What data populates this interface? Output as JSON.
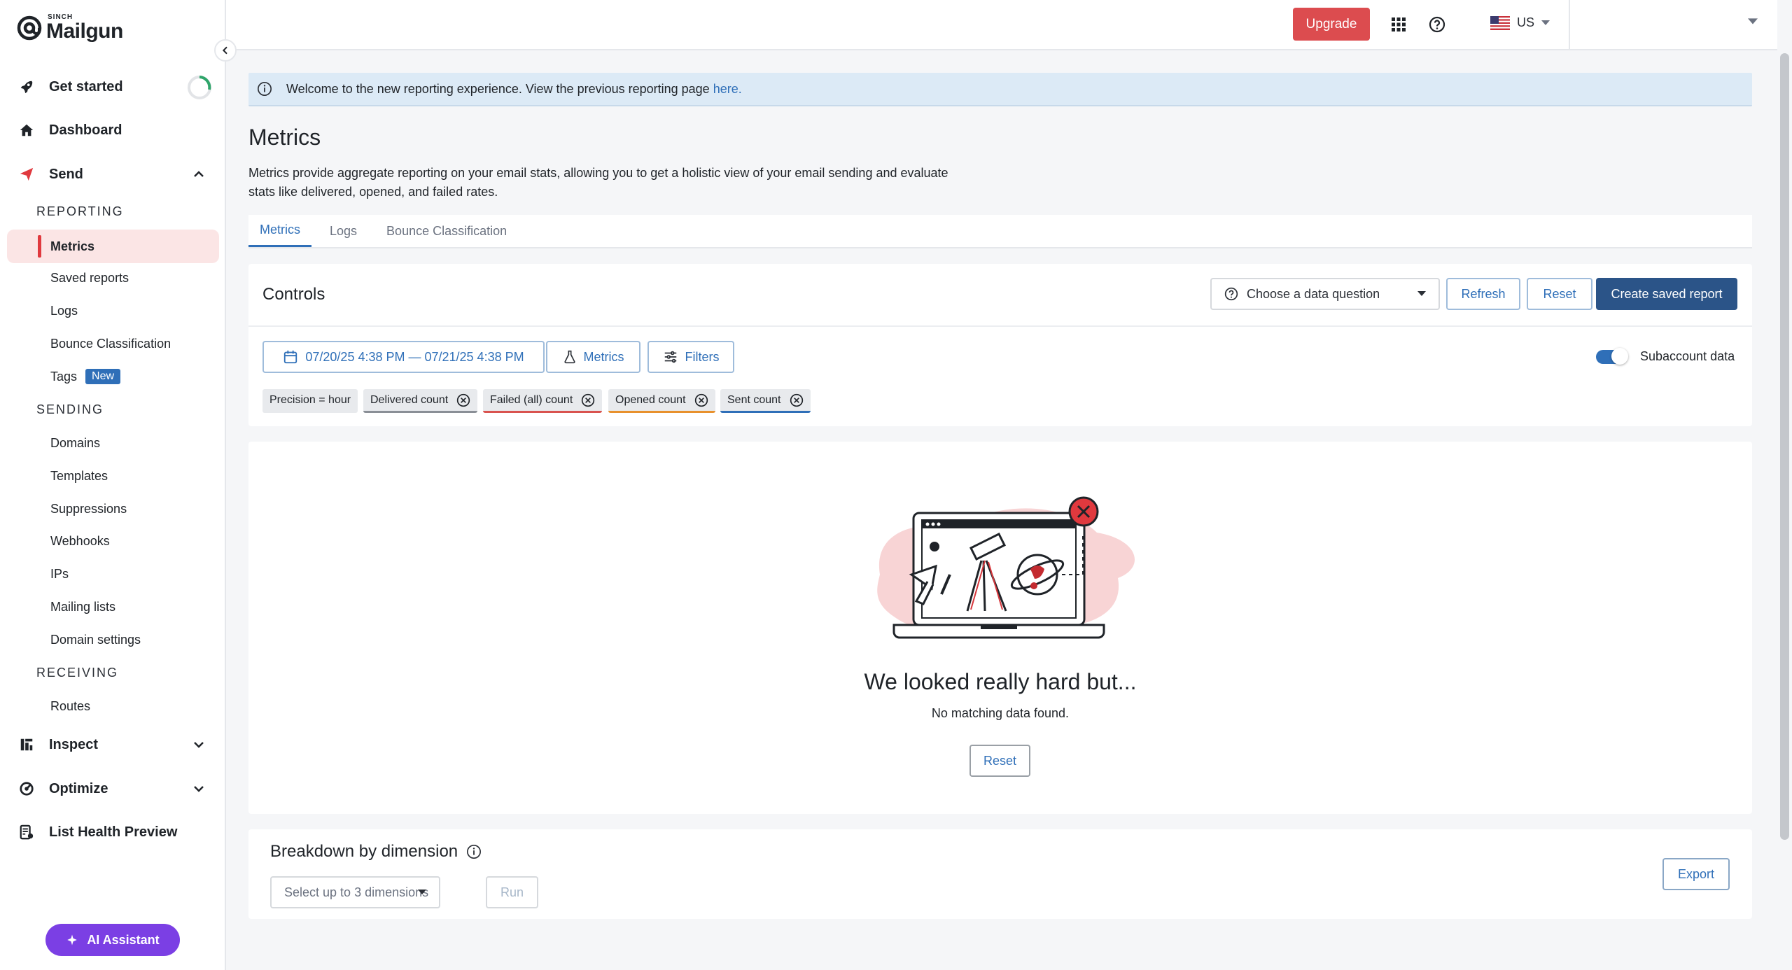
{
  "app": {
    "brand_small": "SINCH",
    "brand_name": "Mailgun"
  },
  "sidebar": {
    "top_items": [
      {
        "label": "Get started",
        "icon": "rocket-icon"
      },
      {
        "label": "Dashboard",
        "icon": "home-icon"
      },
      {
        "label": "Send",
        "icon": "send-icon"
      }
    ],
    "reporting_header": "REPORTING",
    "reporting_items": [
      "Metrics",
      "Saved reports",
      "Logs",
      "Bounce Classification",
      "Tags"
    ],
    "tags_badge": "New",
    "sending_header": "SENDING",
    "sending_items": [
      "Domains",
      "Templates",
      "Suppressions",
      "Webhooks",
      "IPs",
      "Mailing lists",
      "Domain settings"
    ],
    "receiving_header": "RECEIVING",
    "receiving_items": [
      "Routes"
    ],
    "bottom_items": [
      {
        "label": "Inspect",
        "icon": "inspect-icon"
      },
      {
        "label": "Optimize",
        "icon": "optimize-icon"
      },
      {
        "label": "List Health Preview",
        "icon": "list-health-icon"
      }
    ],
    "ai_assistant_label": "AI Assistant",
    "active_item": "Metrics"
  },
  "topbar": {
    "upgrade_label": "Upgrade",
    "region_label": "US"
  },
  "banner": {
    "text": "Welcome to the new reporting experience. View the previous reporting page",
    "link_text": "here."
  },
  "page": {
    "title": "Metrics",
    "description": "Metrics provide aggregate reporting on your email stats, allowing you to get a holistic view of your email sending and evaluate stats like delivered, opened, and failed rates."
  },
  "tabs": [
    {
      "label": "Metrics",
      "active": true
    },
    {
      "label": "Logs",
      "active": false
    },
    {
      "label": "Bounce Classification",
      "active": false
    }
  ],
  "controls": {
    "title": "Controls",
    "data_question_label": "Choose a data question",
    "refresh_label": "Refresh",
    "reset_label": "Reset",
    "create_saved_report_label": "Create saved report",
    "date_range": "07/20/25 4:38 PM — 07/21/25 4:38 PM",
    "metrics_label": "Metrics",
    "filters_label": "Filters",
    "subaccount_label": "Subaccount data",
    "subaccount_enabled": true,
    "chips": [
      {
        "label": "Precision = hour",
        "removable": false,
        "color": "#e8eaed"
      },
      {
        "label": "Delivered count",
        "removable": true,
        "color": "#8a8f96"
      },
      {
        "label": "Failed (all) count",
        "removable": true,
        "color": "#d9534f"
      },
      {
        "label": "Opened count",
        "removable": true,
        "color": "#e8912d"
      },
      {
        "label": "Sent count",
        "removable": true,
        "color": "#2f6fb8"
      }
    ]
  },
  "empty_state": {
    "title": "We looked really hard but...",
    "subtitle": "No matching data found.",
    "reset_label": "Reset"
  },
  "breakdown": {
    "title": "Breakdown by dimension",
    "select_placeholder": "Select up to 3 dimensions",
    "run_label": "Run",
    "export_label": "Export"
  }
}
